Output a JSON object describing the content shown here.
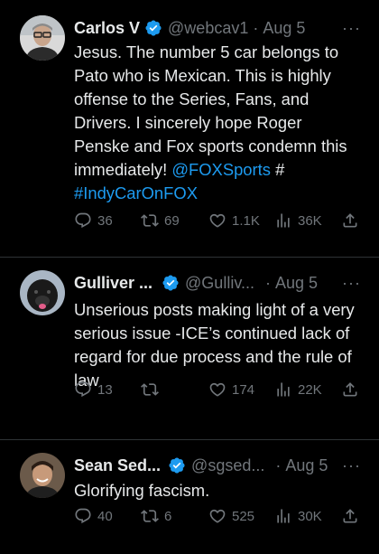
{
  "tweets": [
    {
      "name": "Carlos V",
      "handle": "@webcav1",
      "sep": "·",
      "date": "Aug 5",
      "more": "···",
      "text": "Jesus. The number 5 car belongs to Pato who is Mexican. This is highly offense to the Series, Fans, and Drivers. I sincerely hope Roger Penske and Fox sports condemn this immediately! ",
      "mention": "@FOXSports",
      "hash_symbol": " #",
      "hashtag": "#IndyCarOnFOX",
      "replies": "36",
      "retweets": "69",
      "likes": "1.1K",
      "views": "36K"
    },
    {
      "name": "Gulliver ...",
      "handle": "@Gulliv...",
      "sep": "·",
      "date": "Aug 5",
      "more": "···",
      "text": "Unserious posts making light of a very serious issue -ICE’s continued lack of regard for due process and the rule of law",
      "replies": "13",
      "retweets": "",
      "likes": "174",
      "views": "22K"
    },
    {
      "name": "Sean Sed...",
      "handle": "@sgsed...",
      "sep": "·",
      "date": "Aug 5",
      "more": "···",
      "text": "Glorifying fascism.",
      "replies": "40",
      "retweets": "6",
      "likes": "525",
      "views": "30K"
    }
  ],
  "colors": {
    "background": "#000000",
    "text": "#e7e9ea",
    "muted": "#71767b",
    "link": "#1d9bf0",
    "divider": "#2f3336",
    "verified": "#1d9bf0"
  },
  "icons": {
    "verified": "verified-badge-icon",
    "reply": "reply-icon",
    "retweet": "retweet-icon",
    "like": "heart-icon",
    "views": "views-icon",
    "share": "share-icon",
    "more": "more-icon"
  }
}
